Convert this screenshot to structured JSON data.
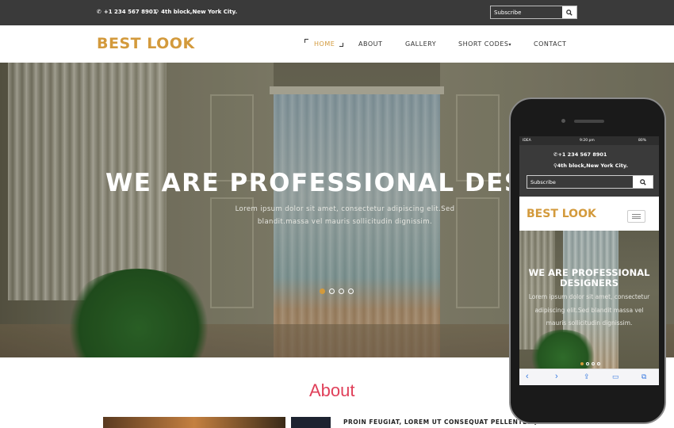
{
  "topbar": {
    "phone": "+1 234 567 8901",
    "address": "4th block,New York City.",
    "subscribe_placeholder": "Subscribe"
  },
  "header": {
    "logo": "BEST LOOK",
    "nav": [
      {
        "label": "HOME",
        "active": true
      },
      {
        "label": "ABOUT"
      },
      {
        "label": "GALLERY"
      },
      {
        "label": "SHORT CODES"
      },
      {
        "label": "CONTACT"
      }
    ]
  },
  "hero": {
    "title": "WE ARE PROFESSIONAL DESIG",
    "text": "Lorem ipsum dolor sit amet, consectetur adipiscing elit.Sed blandit.massa vel mauris sollicitudin dignissim.",
    "slides": 4,
    "active_slide": 0
  },
  "about": {
    "title": "About",
    "heading": "PROIN FEUGIAT, LOREM UT CONSEQUAT PELLENTESQ"
  },
  "phone_mockup": {
    "status": {
      "carrier": "IDEA",
      "time": "9:20 pm",
      "battery": "80%"
    },
    "phone": "+1 234 567 8901",
    "address": "4th block,New York City.",
    "subscribe_placeholder": "Subscribe",
    "logo": "BEST LOOK",
    "hero_title": "WE ARE PROFESSIONAL DESIGNERS",
    "hero_text": "Lorem ipsum dolor sit amet, consectetur adipiscing elit.Sed blandit massa vel mauris sollicitudin dignissim."
  },
  "colors": {
    "accent": "#d39a3c",
    "about_title": "#e0405a",
    "topbar": "#3a3a3a"
  },
  "icons": [
    "phone-icon",
    "map-marker-icon",
    "search-icon",
    "caret-down-icon",
    "menu-icon",
    "back-icon",
    "forward-icon",
    "share-icon",
    "bookmarks-icon",
    "tabs-icon"
  ]
}
